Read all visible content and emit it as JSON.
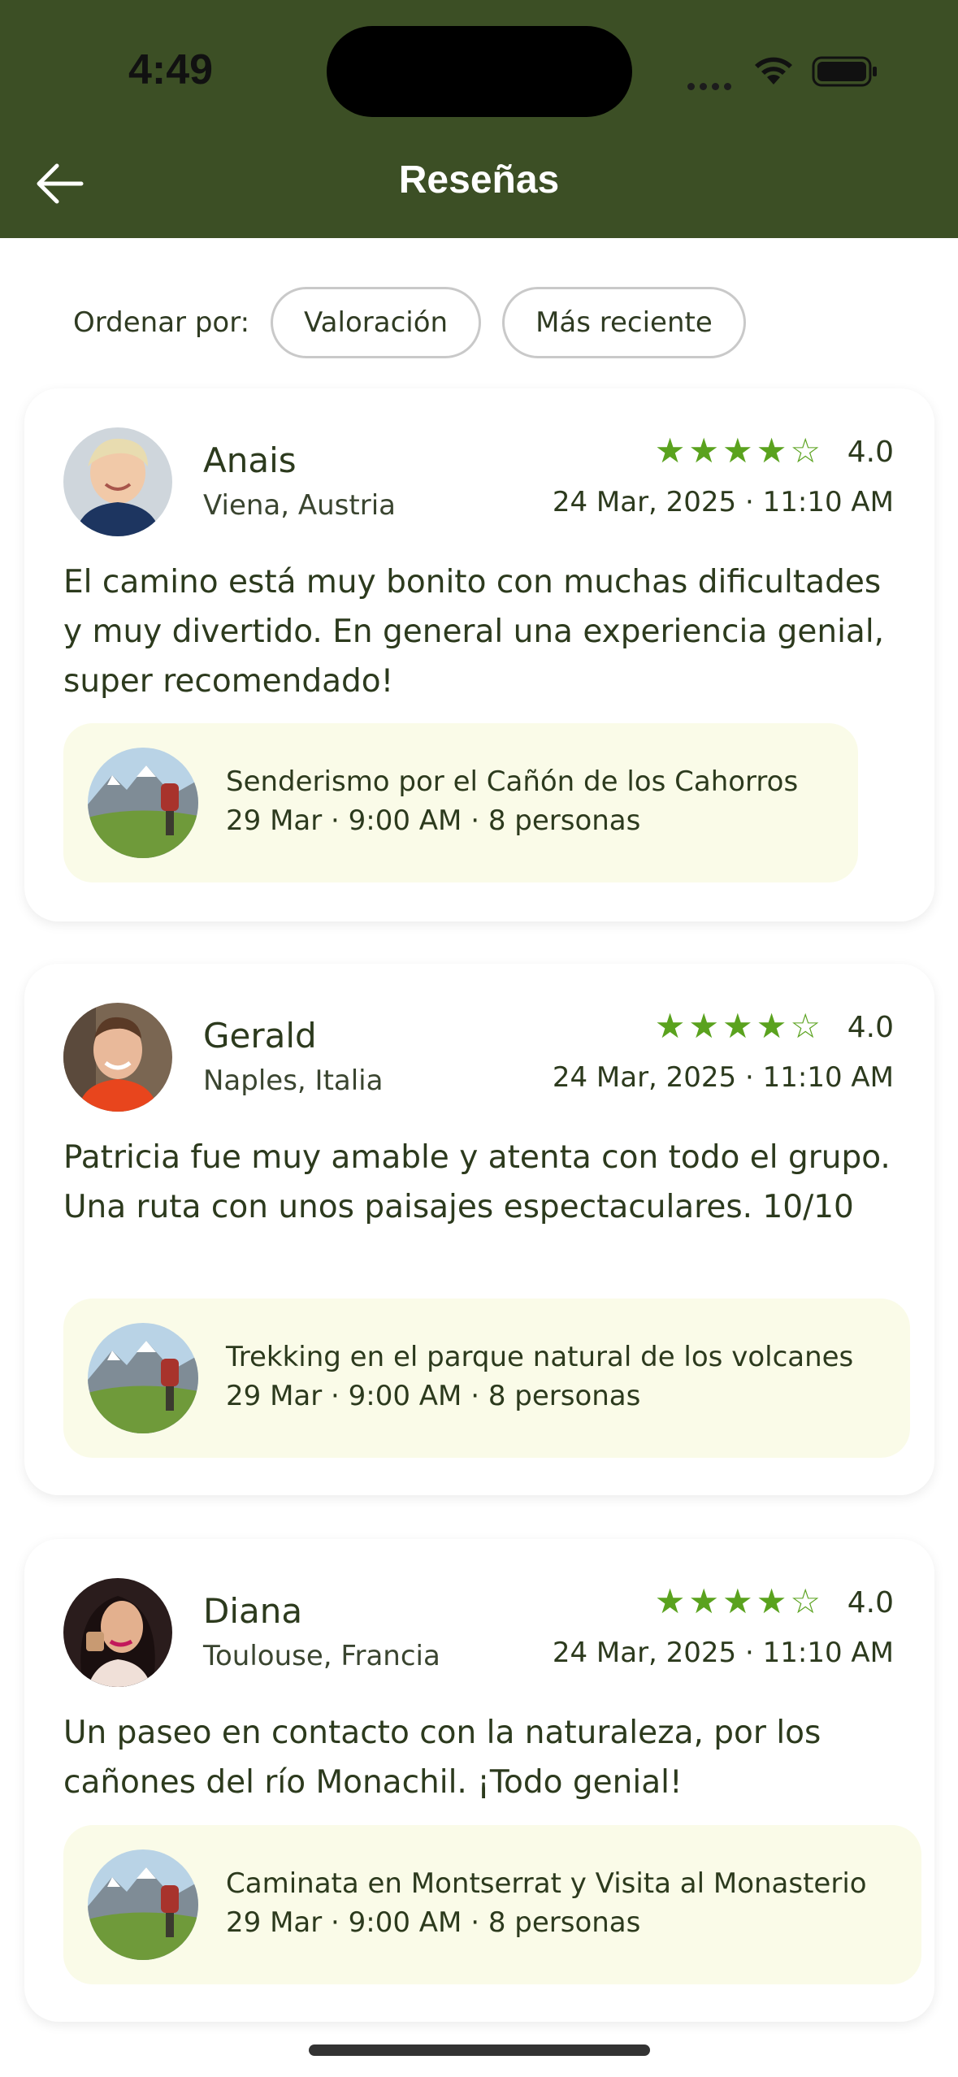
{
  "status_bar": {
    "time": "4:49"
  },
  "header": {
    "title": "Reseñas",
    "back_icon": "arrow-left-icon"
  },
  "sort": {
    "label": "Ordenar por:",
    "options": [
      "Valoración",
      "Más reciente"
    ]
  },
  "colors": {
    "header_bg": "#3c4f25",
    "star": "#5aa21e",
    "activity_bg": "#fafbe8"
  },
  "reviews": [
    {
      "name": "Anais",
      "location": "Viena, Austria",
      "rating_value": 4,
      "rating": "4.0",
      "date": "24 Mar, 2025 · 11:10 AM",
      "text": "El camino está muy bonito con muchas dificultades y muy divertido. En general una experiencia genial, super recomendado!",
      "activity": {
        "title": "Senderismo por el Cañón de los Cahorros",
        "meta": "29 Mar · 9:00 AM · 8 personas"
      }
    },
    {
      "name": "Gerald",
      "location": "Naples, Italia",
      "rating_value": 4,
      "rating": "4.0",
      "date": "24 Mar, 2025 · 11:10 AM",
      "text": "Patricia fue muy amable y atenta con todo el grupo. Una ruta con unos paisajes espectaculares. 10/10",
      "activity": {
        "title": "Trekking en el parque natural de los volcanes",
        "meta": "29 Mar · 9:00 AM · 8 personas"
      }
    },
    {
      "name": "Diana",
      "location": "Toulouse, Francia",
      "rating_value": 4,
      "rating": "4.0",
      "date": "24 Mar, 2025 · 11:10 AM",
      "text": "Un paseo en contacto con la naturaleza, por los cañones del río Monachil. ¡Todo genial!",
      "activity": {
        "title": "Caminata en Montserrat y Visita al Monasterio",
        "meta": "29 Mar · 9:00 AM · 8 personas"
      }
    }
  ]
}
